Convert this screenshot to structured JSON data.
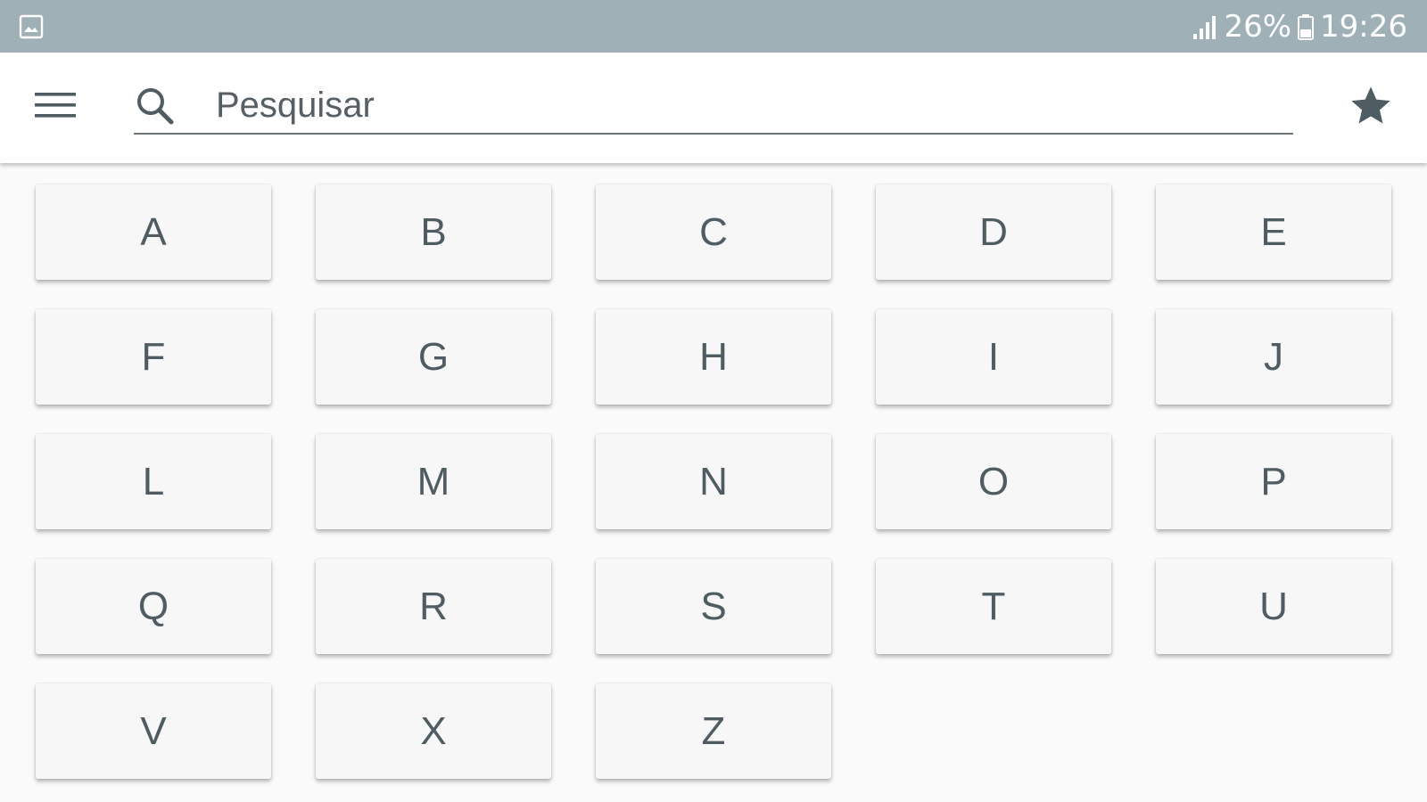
{
  "status_bar": {
    "left_icon": "image-notification-icon",
    "signal_icon": "signal-icon",
    "battery_percent": "26%",
    "battery_icon": "battery-icon",
    "time": "19:26",
    "color": "#9fb0b7"
  },
  "app_bar": {
    "menu_icon": "hamburger-menu-icon",
    "search_icon": "search-icon",
    "search_placeholder": "Pesquisar",
    "search_value": "",
    "favorite_icon": "star-icon"
  },
  "letters": [
    "A",
    "B",
    "C",
    "D",
    "E",
    "F",
    "G",
    "H",
    "I",
    "J",
    "L",
    "M",
    "N",
    "O",
    "P",
    "Q",
    "R",
    "S",
    "T",
    "U",
    "V",
    "X",
    "Z"
  ],
  "colors": {
    "accent": "#4f5d63",
    "button_bg": "#f7f7f7",
    "page_bg": "#fafafa"
  }
}
